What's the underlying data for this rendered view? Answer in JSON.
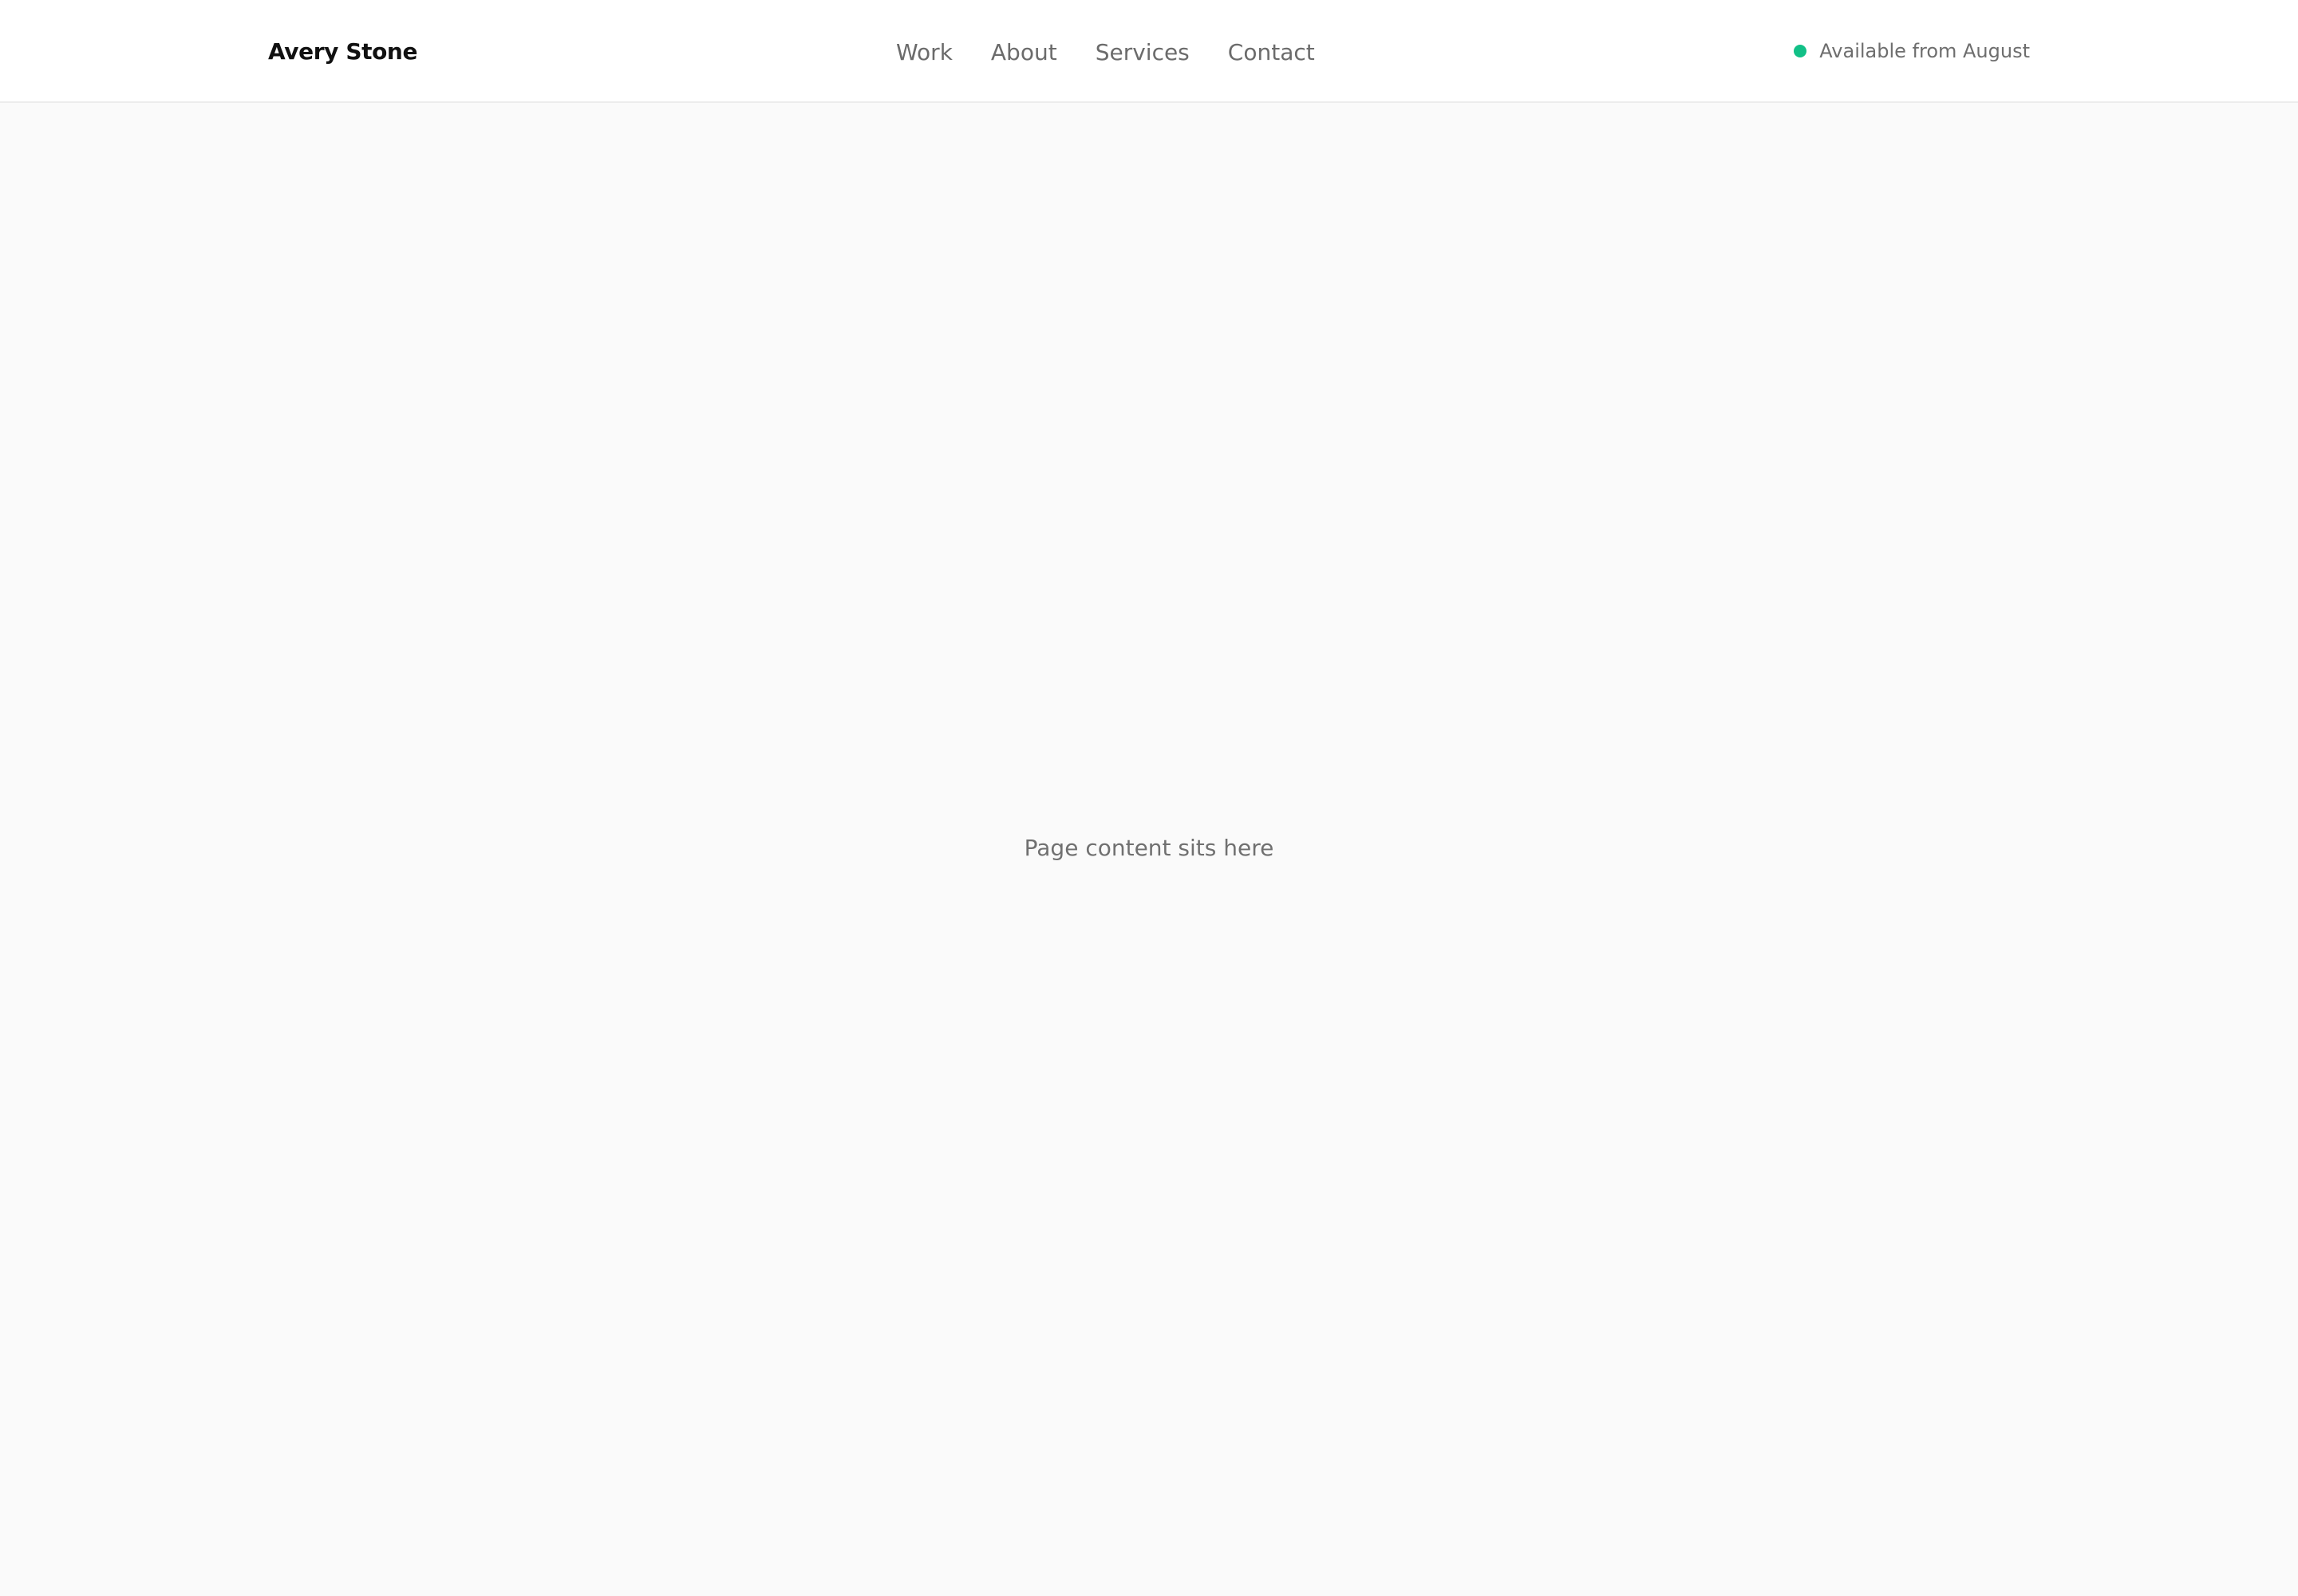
{
  "header": {
    "brand": "Avery Stone",
    "nav": [
      {
        "label": "Work"
      },
      {
        "label": "About"
      },
      {
        "label": "Services"
      },
      {
        "label": "Contact"
      }
    ],
    "availability": {
      "text": "Available from August",
      "dot_color": "#12c087"
    }
  },
  "main": {
    "placeholder": "Page content sits here"
  },
  "colors": {
    "background": "#fafafa",
    "header_background": "#ffffff",
    "brand_text": "#111111",
    "nav_text": "#6b6b6b",
    "status_accent": "#12c087"
  }
}
